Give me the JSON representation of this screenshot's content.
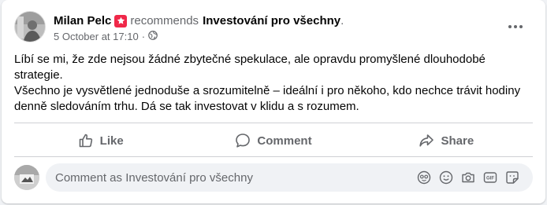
{
  "post": {
    "author": "Milan Pelc",
    "verb": "recommends",
    "page_name": "Investování pro všechny",
    "page_suffix": ".",
    "timestamp": "5 October at 17:10",
    "separator": "·",
    "body_lines": [
      "Líbí se mi, že zde nejsou žádné zbytečné spekulace, ale opravdu promyšlené dlouhodobé strategie.",
      "Všechno je vysvětlené jednoduše a srozumitelně – ideální i pro někoho, kdo nechce trávit hodiny denně sledováním trhu. Dá se tak investovat v klidu a s rozumem."
    ]
  },
  "actions": {
    "like": "Like",
    "comment": "Comment",
    "share": "Share"
  },
  "comment_input": {
    "placeholder": "Comment as Investování pro všechny"
  },
  "colors": {
    "badge": "#f02849",
    "secondary_text": "#65676b",
    "primary_text": "#050505",
    "background": "#f0f2f5"
  },
  "icons": [
    "recommend-badge-icon",
    "globe-icon",
    "more-options-icon",
    "like-icon",
    "comment-icon",
    "share-icon",
    "avatar-sticker-icon",
    "emoji-icon",
    "camera-icon",
    "gif-icon",
    "sticker-icon"
  ]
}
